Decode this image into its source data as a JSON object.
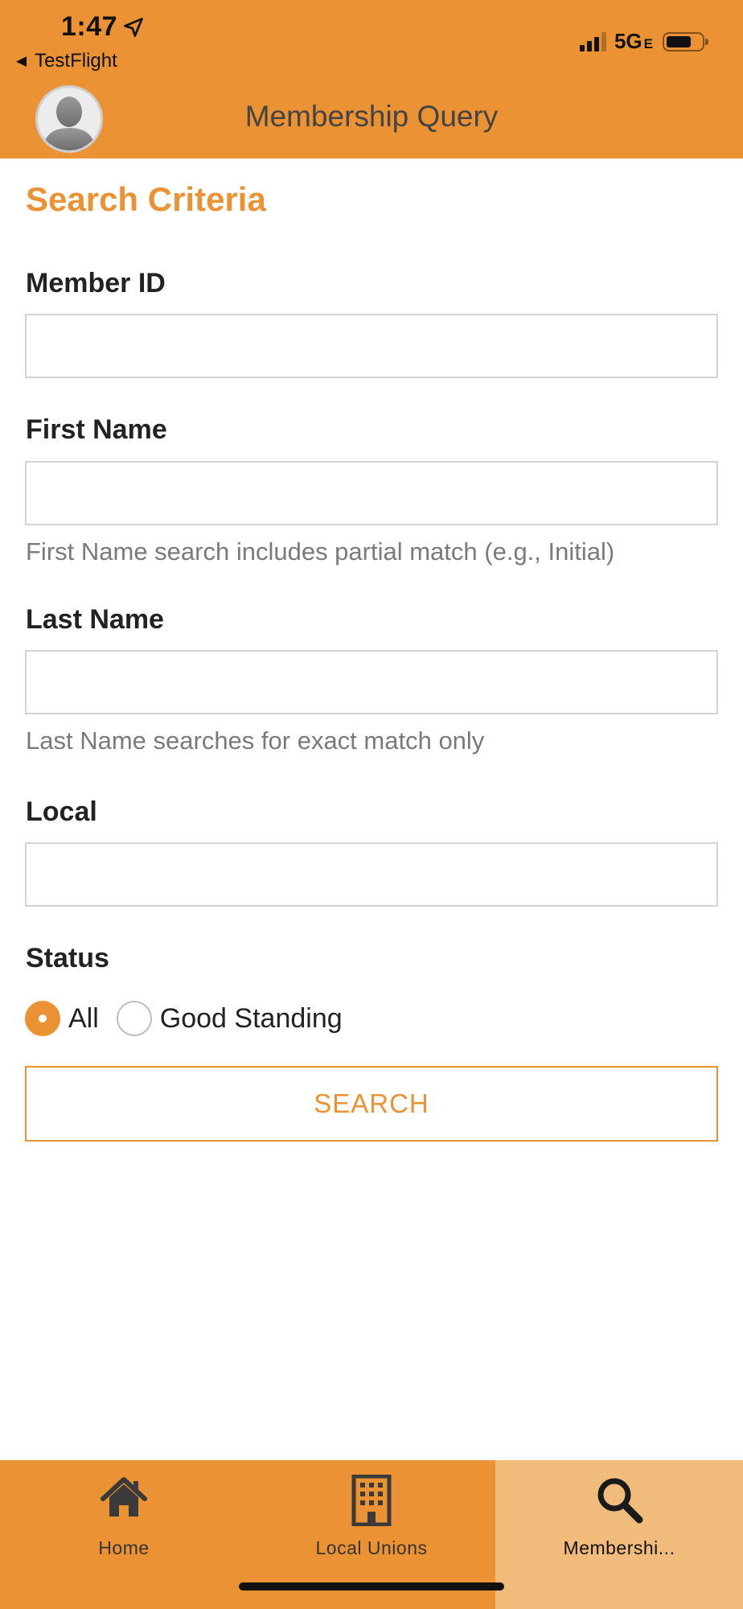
{
  "status_bar": {
    "time": "1:47",
    "back_app": "TestFlight",
    "network": "5G",
    "network_suffix": "E"
  },
  "header": {
    "title": "Membership Query"
  },
  "form": {
    "section_title": "Search Criteria",
    "member_id": {
      "label": "Member ID",
      "value": ""
    },
    "first_name": {
      "label": "First Name",
      "value": "",
      "hint": "First Name search includes partial match (e.g., Initial)"
    },
    "last_name": {
      "label": "Last Name",
      "value": "",
      "hint": "Last Name searches for exact match only"
    },
    "local": {
      "label": "Local",
      "value": ""
    },
    "status": {
      "label": "Status",
      "options": [
        {
          "label": "All",
          "selected": true
        },
        {
          "label": "Good Standing",
          "selected": false
        }
      ]
    },
    "search_label": "SEARCH"
  },
  "tabbar": {
    "tabs": [
      {
        "label": "Home",
        "icon": "home-icon",
        "active": false
      },
      {
        "label": "Local Unions",
        "icon": "building-icon",
        "active": false
      },
      {
        "label": "Membershi...",
        "icon": "search-icon",
        "active": true
      }
    ]
  },
  "colors": {
    "accent": "#EB9334",
    "active_tab": "#F1BB7C"
  }
}
